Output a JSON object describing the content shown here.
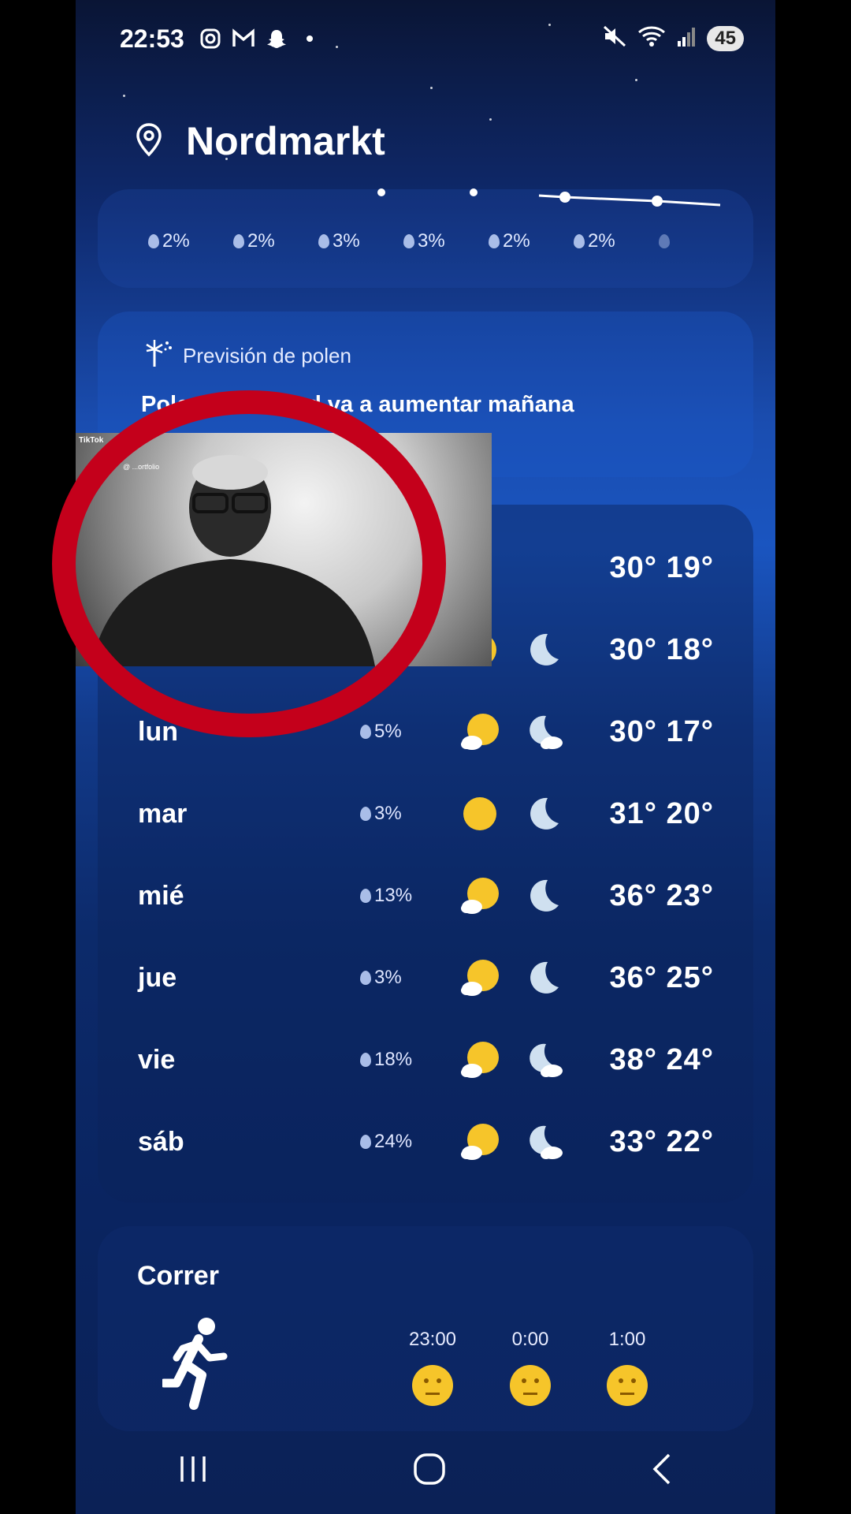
{
  "status_bar": {
    "time": "22:53",
    "battery": "45"
  },
  "header": {
    "location": "Nordmarkt"
  },
  "hourly": {
    "precip": [
      "2%",
      "2%",
      "3%",
      "3%",
      "2%",
      "2%"
    ]
  },
  "pollen": {
    "title": "Previsión de polen",
    "text": "Polen de césped va a aumentar mañana"
  },
  "daily": [
    {
      "day": "",
      "precip": "",
      "sun_icon": "",
      "moon_icon": "",
      "temps": "30° 19°"
    },
    {
      "day": "",
      "precip": "",
      "sun_icon": "sun-icon",
      "moon_icon": "moon-icon",
      "temps": "30° 18°"
    },
    {
      "day": "lun",
      "precip": "5%",
      "sun_icon": "partly-cloudy-sun-icon",
      "moon_icon": "partly-cloudy-moon-icon",
      "temps": "30° 17°"
    },
    {
      "day": "mar",
      "precip": "3%",
      "sun_icon": "sun-icon",
      "moon_icon": "moon-icon",
      "temps": "31° 20°"
    },
    {
      "day": "mié",
      "precip": "13%",
      "sun_icon": "partly-cloudy-sun-icon",
      "moon_icon": "moon-icon",
      "temps": "36° 23°"
    },
    {
      "day": "jue",
      "precip": "3%",
      "sun_icon": "partly-cloudy-sun-icon",
      "moon_icon": "moon-icon",
      "temps": "36° 25°"
    },
    {
      "day": "vie",
      "precip": "18%",
      "sun_icon": "partly-cloudy-sun-icon",
      "moon_icon": "partly-cloudy-moon-icon",
      "temps": "38° 24°"
    },
    {
      "day": "sáb",
      "precip": "24%",
      "sun_icon": "partly-cloudy-sun-icon",
      "moon_icon": "partly-cloudy-moon-icon",
      "temps": "33° 22°"
    }
  ],
  "running": {
    "title": "Correr",
    "slots": [
      {
        "time": "23:00"
      },
      {
        "time": "0:00"
      },
      {
        "time": "1:00"
      }
    ]
  },
  "overlay": {
    "app": "TikTok",
    "handle": "@ ...ortfolio"
  },
  "colors": {
    "accent_ring": "#c4001b",
    "sun": "#f6c52a"
  }
}
